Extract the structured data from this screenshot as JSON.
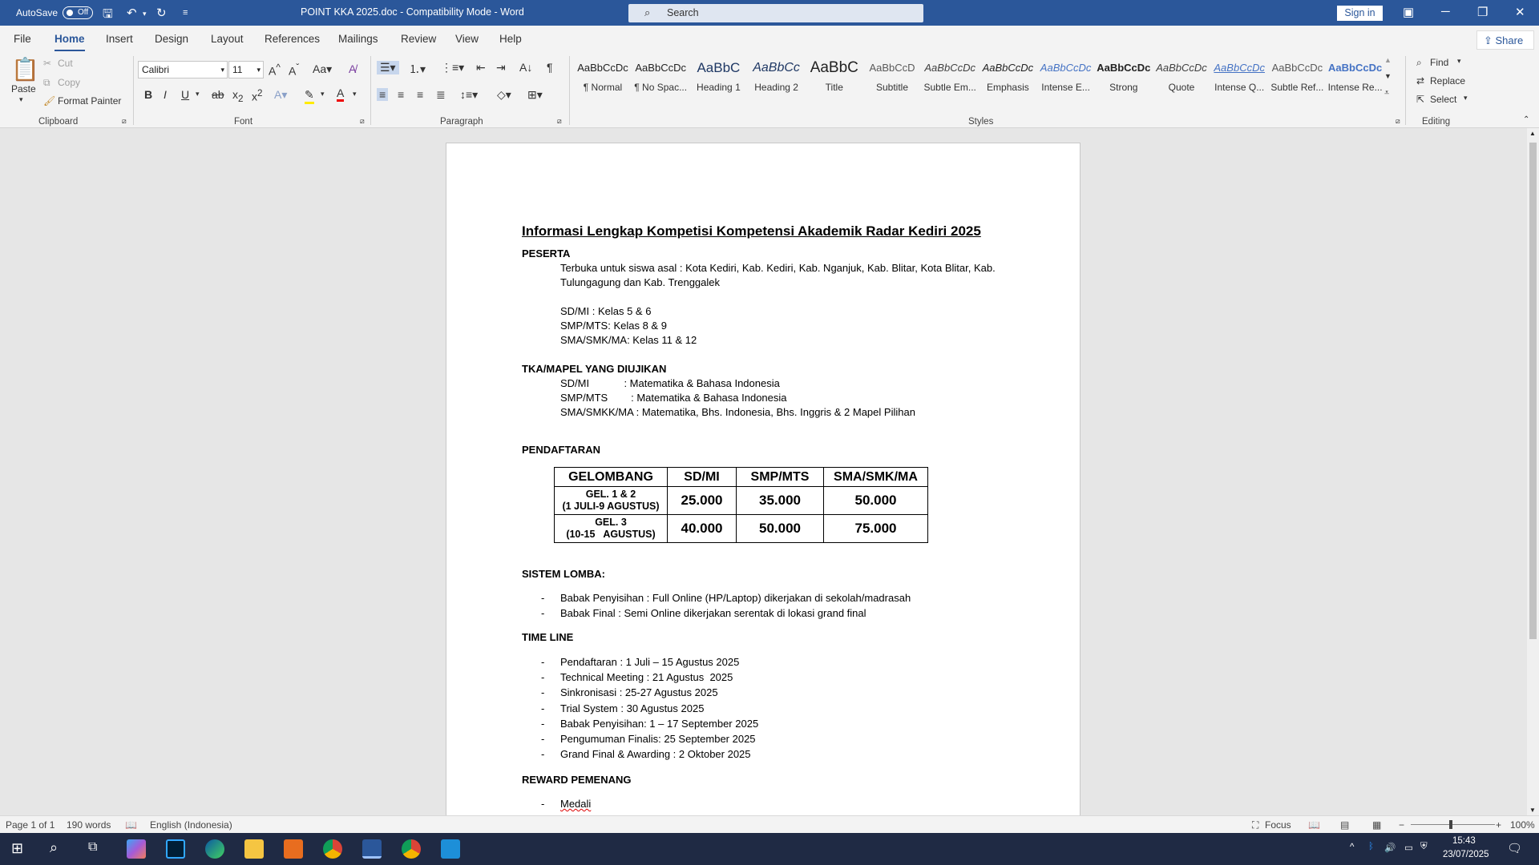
{
  "titlebar": {
    "autosave": "AutoSave",
    "toggle": "Off",
    "doc_title": "POINT KKA 2025.doc  -  Compatibility Mode  -  Word",
    "search": "Search",
    "signin": "Sign in"
  },
  "tabs": [
    "File",
    "Home",
    "Insert",
    "Design",
    "Layout",
    "References",
    "Mailings",
    "Review",
    "View",
    "Help"
  ],
  "share": "Share",
  "clipboard": {
    "paste": "Paste",
    "cut": "Cut",
    "copy": "Copy",
    "format_painter": "Format Painter",
    "label": "Clipboard"
  },
  "font": {
    "name": "Calibri",
    "size": "11",
    "label": "Font"
  },
  "paragraph": {
    "label": "Paragraph"
  },
  "styles": {
    "label": "Styles",
    "items": [
      {
        "preview": "AaBbCcDc",
        "name": "¶ Normal"
      },
      {
        "preview": "AaBbCcDc",
        "name": "¶ No Spac..."
      },
      {
        "preview": "AaBbC",
        "name": "Heading 1"
      },
      {
        "preview": "AaBbCc",
        "name": "Heading 2"
      },
      {
        "preview": "AaBbC",
        "name": "Title"
      },
      {
        "preview": "AaBbCcD",
        "name": "Subtitle"
      },
      {
        "preview": "AaBbCcDc",
        "name": "Subtle Em..."
      },
      {
        "preview": "AaBbCcDc",
        "name": "Emphasis"
      },
      {
        "preview": "AaBbCcDc",
        "name": "Intense E..."
      },
      {
        "preview": "AaBbCcDc",
        "name": "Strong"
      },
      {
        "preview": "AaBbCcDc",
        "name": "Quote"
      },
      {
        "preview": "AaBbCcDc",
        "name": "Intense Q..."
      },
      {
        "preview": "AaBbCcDc",
        "name": "Subtle Ref..."
      },
      {
        "preview": "AaBbCcDc",
        "name": "Intense Re..."
      }
    ]
  },
  "editing": {
    "find": "Find",
    "replace": "Replace",
    "select": "Select",
    "label": "Editing"
  },
  "document": {
    "title": "Informasi Lengkap Kompetisi Kompetensi Akademik Radar Kediri 2025",
    "peserta_heading": "PESERTA",
    "peserta_line1": "Terbuka untuk siswa asal : Kota Kediri, Kab. Kediri, Kab. Nganjuk, Kab. Blitar, Kota Blitar, Kab.",
    "peserta_line2": "Tulungagung dan Kab. Trenggalek",
    "level1": "SD/MI : Kelas 5 & 6",
    "level2": "SMP/MTS: Kelas 8 & 9",
    "level3": "SMA/SMK/MA: Kelas 11 & 12",
    "mapel_heading": "TKA/MAPEL YANG DIUJIKAN",
    "mapel1": "SD/MI            : Matematika & Bahasa Indonesia",
    "mapel2": "SMP/MTS        : Matematika & Bahasa Indonesia",
    "mapel3": "SMA/SMKK/MA : Matematika, Bhs. Indonesia, Bhs. Inggris & 2 Mapel Pilihan",
    "pendaftaran_heading": "PENDAFTARAN",
    "table": {
      "headers": [
        "GELOMBANG",
        "SD/MI",
        "SMP/MTS",
        "SMA/SMK/MA"
      ],
      "rows": [
        {
          "g1": "GEL. 1 & 2",
          "g2": "(1 JULI-9 AGUSTUS)",
          "v": [
            "25.000",
            "35.000",
            "50.000"
          ]
        },
        {
          "g1": "GEL. 3",
          "g2": "(10-15   AGUSTUS)",
          "v": [
            "40.000",
            "50.000",
            "75.000"
          ]
        }
      ]
    },
    "sistem_heading": "SISTEM LOMBA:",
    "sistem": [
      "Babak Penyisihan : Full Online (HP/Laptop) dikerjakan di sekolah/madrasah",
      "Babak Final : Semi Online dikerjakan serentak di lokasi grand final"
    ],
    "timeline_heading": "TIME LINE",
    "timeline": [
      "Pendaftaran : 1 Juli – 15 Agustus 2025",
      "Technical Meeting : 21 Agustus  2025",
      "Sinkronisasi : 25-27 Agustus 2025",
      "Trial System : 30 Agustus 2025",
      "Babak Penyisihan: 1 – 17 September 2025",
      "Pengumuman Finalis: 25 September 2025",
      "Grand Final & Awarding : 2 Oktober 2025"
    ],
    "reward_heading": "REWARD PEMENANG",
    "reward": [
      "Medali"
    ],
    "dash": "-"
  },
  "status": {
    "page": "Page 1 of 1",
    "words": "190 words",
    "language": "English (Indonesia)",
    "focus": "Focus",
    "zoom": "100%"
  },
  "tray": {
    "time": "15:43",
    "date": "23/07/2025"
  },
  "colors": {
    "accent": "#2b579a"
  }
}
